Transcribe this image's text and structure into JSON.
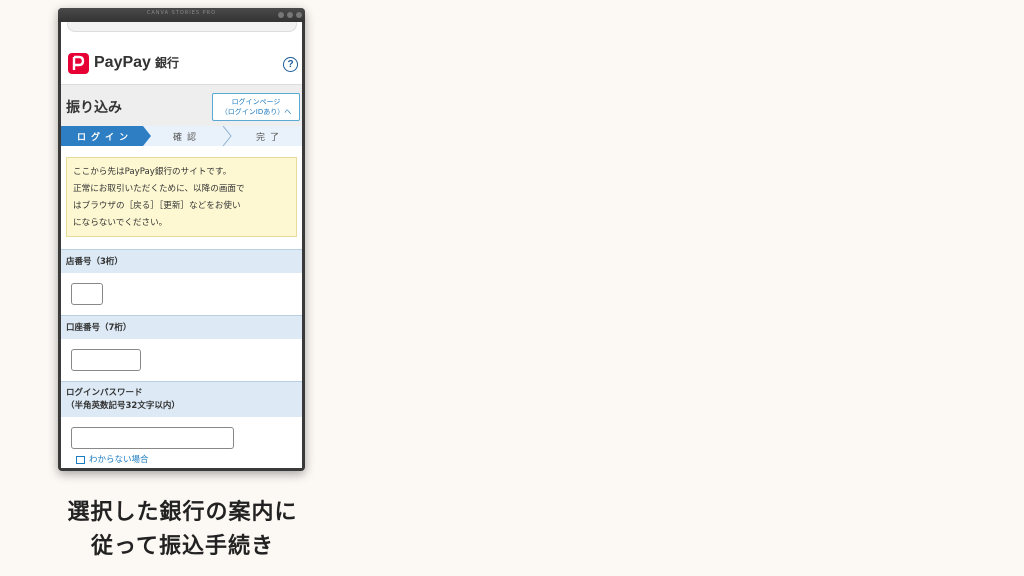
{
  "window": {
    "title": "CANVA STORIES PRO"
  },
  "header": {
    "brand": "PayPay",
    "bank_suffix": "銀行",
    "help_icon": "?"
  },
  "page": {
    "title": "振り込み",
    "login_link_line1": "ログインページ",
    "login_link_line2": "（ログインIDあり）へ"
  },
  "steps": [
    {
      "label": "ログイン",
      "active": true
    },
    {
      "label": "確認",
      "active": false
    },
    {
      "label": "完了",
      "active": false
    }
  ],
  "notice": {
    "line1": "ここから先はPayPay銀行のサイトです。",
    "line2": "正常にお取引いただくために、以降の画面で",
    "line3": "はブラウザの［戻る］［更新］などをお使い",
    "line4": "にならないでください。"
  },
  "form": {
    "branch_label": "店番号（3桁）",
    "branch_value": "",
    "account_label": "口座番号（7桁）",
    "account_value": "",
    "password_label_line1": "ログインパスワード",
    "password_label_line2": "（半角英数記号32文字以内）",
    "password_value": "",
    "forgot_link": "わからない場合"
  },
  "caption": {
    "line1": "選択した銀行の案内に",
    "line2": "従って振込手続き"
  },
  "colors": {
    "brand_red": "#e60033",
    "step_active": "#2e7ec4",
    "link_blue": "#1d7bbf",
    "notice_bg": "#fdf8d2",
    "section_bg": "#ddeaf6"
  }
}
